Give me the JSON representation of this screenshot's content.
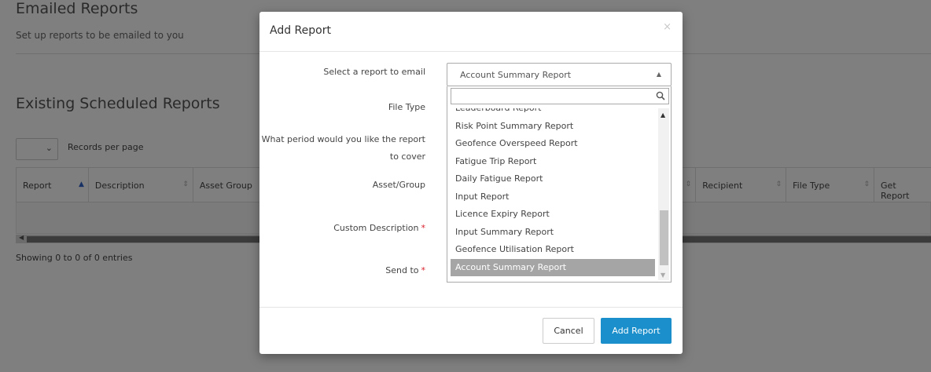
{
  "page": {
    "title": "Emailed Reports",
    "subtitle": "Set up reports to be emailed to you",
    "section_title": "Existing Scheduled Reports",
    "records_label": "Records per page",
    "showing": "Showing 0 to 0 of 0 entries",
    "columns": [
      "Report",
      "Description",
      "Asset Group",
      "Recipient",
      "File Type",
      "Get Report"
    ]
  },
  "modal": {
    "title": "Add Report",
    "close_glyph": "×",
    "labels": {
      "select_report": "Select a report to email",
      "file_type": "File Type",
      "period_line1": "What period would you like the report",
      "period_line2": "to cover",
      "asset_group": "Asset/Group",
      "custom_description": "Custom Description",
      "send_to": "Send to"
    },
    "required_mark": "*",
    "selected_report": "Account Summary Report",
    "search_placeholder": "",
    "options": [
      "Leaderboard Report",
      "Risk Point Summary Report",
      "Geofence Overspeed Report",
      "Fatigue Trip Report",
      "Daily Fatigue Report",
      "Input Report",
      "Licence Expiry Report",
      "Input Summary Report",
      "Geofence Utilisation Report",
      "Account Summary Report"
    ],
    "selected_index": 9,
    "cancel_label": "Cancel",
    "add_label": "Add Report"
  },
  "colors": {
    "primary_button": "#1a8fcb",
    "selected_option": "#a5a5a5",
    "required": "#d9212c",
    "sort_active": "#2f62c8"
  },
  "icons": [
    "chevron-down-icon",
    "caret-up-icon",
    "search-icon",
    "close-icon",
    "sort-icon",
    "scroll-up-icon",
    "scroll-down-icon"
  ]
}
